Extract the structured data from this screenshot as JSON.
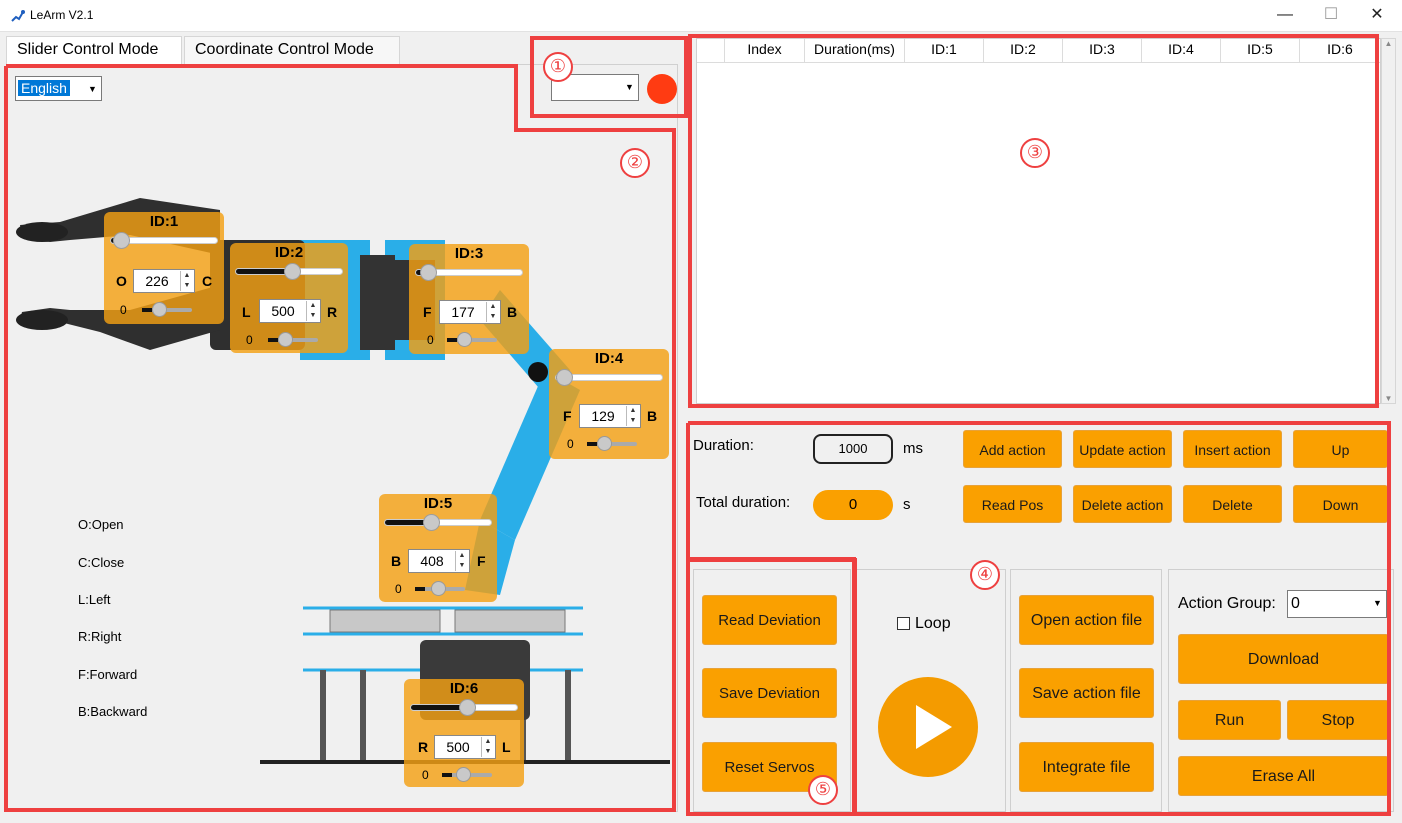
{
  "window": {
    "title": "LeArm V2.1",
    "minimize": "—",
    "maximize": "☐",
    "close": "✕"
  },
  "tabs": [
    "Slider Control Mode",
    "Coordinate Control Mode"
  ],
  "language": "English",
  "port": {
    "value": "",
    "status_color": "#ff3b12"
  },
  "annotations": [
    "①",
    "②",
    "③",
    "④",
    "⑤"
  ],
  "servos": [
    {
      "id": "ID:1",
      "left": "O",
      "right": "C",
      "value": "226",
      "zero": "0",
      "level": 0.05
    },
    {
      "id": "ID:2",
      "left": "L",
      "right": "R",
      "value": "500",
      "zero": "0",
      "level": 0.5
    },
    {
      "id": "ID:3",
      "left": "F",
      "right": "B",
      "value": "177",
      "zero": "0",
      "level": 0.08
    },
    {
      "id": "ID:4",
      "left": "F",
      "right": "B",
      "value": "129",
      "zero": "0",
      "level": 0.02
    },
    {
      "id": "ID:5",
      "left": "B",
      "right": "F",
      "value": "408",
      "zero": "0",
      "level": 0.38
    },
    {
      "id": "ID:6",
      "left": "R",
      "right": "L",
      "value": "500",
      "zero": "0",
      "level": 0.5
    }
  ],
  "legend": [
    "O:Open",
    "C:Close",
    "L:Left",
    "R:Right",
    "F:Forward",
    "B:Backward"
  ],
  "table": {
    "columns": [
      "",
      "Index",
      "Duration(ms)",
      "ID:1",
      "ID:2",
      "ID:3",
      "ID:4",
      "ID:5",
      "ID:6"
    ],
    "rows": []
  },
  "controls": {
    "duration_label": "Duration:",
    "duration_value": "1000",
    "duration_unit": "ms",
    "total_label": "Total duration:",
    "total_value": "0",
    "total_unit": "s",
    "buttons": [
      "Add action",
      "Update action",
      "Insert action",
      "Up",
      "Read Pos",
      "Delete action",
      "Delete",
      "Down"
    ]
  },
  "deviation": [
    "Read Deviation",
    "Save Deviation",
    "Reset Servos"
  ],
  "loop_label": "Loop",
  "loop_checked": false,
  "files": [
    "Open action file",
    "Save action file",
    "Integrate file"
  ],
  "group": {
    "label": "Action Group:",
    "value": "0",
    "download": "Download",
    "run": "Run",
    "stop": "Stop",
    "erase": "Erase All"
  },
  "colors": {
    "accent": "#faa000",
    "annotation": "#ee4040",
    "arm_blue": "#2aaee8"
  }
}
